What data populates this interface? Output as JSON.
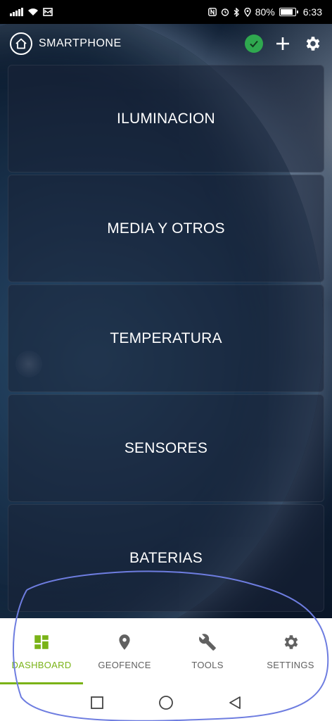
{
  "status_bar": {
    "battery": "80%",
    "time": "6:33"
  },
  "app_bar": {
    "title": "SMARTPHONE",
    "icons": [
      "home-icon",
      "check-circle-icon",
      "plus-icon",
      "gear-icon"
    ]
  },
  "cards": [
    {
      "label": "ILUMINACION"
    },
    {
      "label": "MEDIA Y OTROS"
    },
    {
      "label": "TEMPERATURA"
    },
    {
      "label": "SENSORES"
    },
    {
      "label": "BATERIAS"
    }
  ],
  "bottom_nav": {
    "items": [
      {
        "label": "DASHBOARD",
        "icon": "dashboard-icon",
        "active": true
      },
      {
        "label": "GEOFENCE",
        "icon": "location-pin-icon",
        "active": false
      },
      {
        "label": "TOOLS",
        "icon": "wrench-icon",
        "active": false
      },
      {
        "label": "SETTINGS",
        "icon": "gear-icon",
        "active": false
      }
    ]
  },
  "system_nav": {
    "icons": [
      "recents-square-icon",
      "home-circle-icon",
      "back-triangle-icon"
    ]
  },
  "colors": {
    "accent": "#7ab317",
    "status_ok": "#2fa84f",
    "annotation": "#6e7de0",
    "nav_inactive": "#616161"
  }
}
